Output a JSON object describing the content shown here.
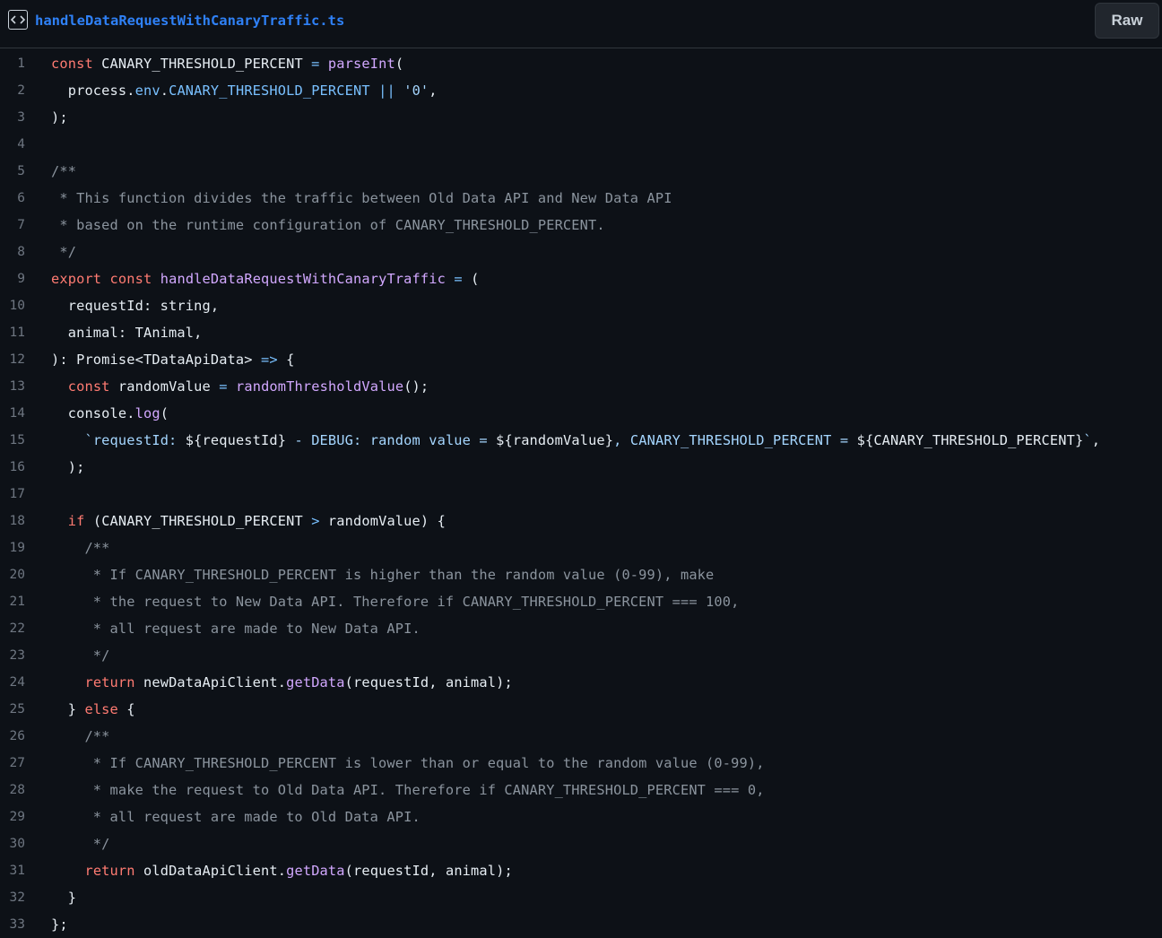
{
  "header": {
    "file_name": "handleDataRequestWithCanaryTraffic.ts",
    "raw_label": "Raw"
  },
  "icons": {
    "file_code": "code-file-icon"
  },
  "colors": {
    "background": "#0d1117",
    "keyword": "#ff7b72",
    "function": "#d2a8ff",
    "constant": "#79c0ff",
    "string": "#a5d6ff",
    "comment": "#8b949e",
    "text": "#e6edf3",
    "link": "#2f81f7"
  },
  "code": {
    "lines": [
      {
        "num": "1",
        "tokens": [
          [
            "keyword",
            "const"
          ],
          [
            "plain",
            " CANARY_THRESHOLD_PERCENT "
          ],
          [
            "const",
            "="
          ],
          [
            "plain",
            " "
          ],
          [
            "fn",
            "parseInt"
          ],
          [
            "plain",
            "("
          ]
        ]
      },
      {
        "num": "2",
        "tokens": [
          [
            "plain",
            "  process."
          ],
          [
            "const",
            "env"
          ],
          [
            "plain",
            "."
          ],
          [
            "const",
            "CANARY_THRESHOLD_PERCENT"
          ],
          [
            "plain",
            " "
          ],
          [
            "const",
            "||"
          ],
          [
            "plain",
            " "
          ],
          [
            "string",
            "'0'"
          ],
          [
            "plain",
            ","
          ]
        ]
      },
      {
        "num": "3",
        "tokens": [
          [
            "plain",
            ");"
          ]
        ]
      },
      {
        "num": "4",
        "tokens": []
      },
      {
        "num": "5",
        "tokens": [
          [
            "comment",
            "/**"
          ]
        ]
      },
      {
        "num": "6",
        "tokens": [
          [
            "comment",
            " * This function divides the traffic between Old Data API and New Data API"
          ]
        ]
      },
      {
        "num": "7",
        "tokens": [
          [
            "comment",
            " * based on the runtime configuration of CANARY_THRESHOLD_PERCENT."
          ]
        ]
      },
      {
        "num": "8",
        "tokens": [
          [
            "comment",
            " */"
          ]
        ]
      },
      {
        "num": "9",
        "tokens": [
          [
            "keyword",
            "export"
          ],
          [
            "plain",
            " "
          ],
          [
            "keyword",
            "const"
          ],
          [
            "plain",
            " "
          ],
          [
            "fn",
            "handleDataRequestWithCanaryTraffic"
          ],
          [
            "plain",
            " "
          ],
          [
            "const",
            "="
          ],
          [
            "plain",
            " ("
          ]
        ]
      },
      {
        "num": "10",
        "tokens": [
          [
            "plain",
            "  requestId: string,"
          ]
        ]
      },
      {
        "num": "11",
        "tokens": [
          [
            "plain",
            "  animal: TAnimal,"
          ]
        ]
      },
      {
        "num": "12",
        "tokens": [
          [
            "plain",
            "): Promise<TDataApiData> "
          ],
          [
            "const",
            "=>"
          ],
          [
            "plain",
            " {"
          ]
        ]
      },
      {
        "num": "13",
        "tokens": [
          [
            "plain",
            "  "
          ],
          [
            "keyword",
            "const"
          ],
          [
            "plain",
            " randomValue "
          ],
          [
            "const",
            "="
          ],
          [
            "plain",
            " "
          ],
          [
            "fn",
            "randomThresholdValue"
          ],
          [
            "plain",
            "();"
          ]
        ]
      },
      {
        "num": "14",
        "tokens": [
          [
            "plain",
            "  console."
          ],
          [
            "fn",
            "log"
          ],
          [
            "plain",
            "("
          ]
        ]
      },
      {
        "num": "15",
        "tokens": [
          [
            "plain",
            "    "
          ],
          [
            "string",
            "`requestId: "
          ],
          [
            "plain",
            "${requestId}"
          ],
          [
            "string",
            " - DEBUG: random value = "
          ],
          [
            "plain",
            "${randomValue}"
          ],
          [
            "string",
            ", CANARY_THRESHOLD_PERCENT = "
          ],
          [
            "plain",
            "${CANARY_THRESHOLD_PERCENT}"
          ],
          [
            "string",
            "`"
          ],
          [
            "plain",
            ","
          ]
        ]
      },
      {
        "num": "16",
        "tokens": [
          [
            "plain",
            "  );"
          ]
        ]
      },
      {
        "num": "17",
        "tokens": []
      },
      {
        "num": "18",
        "tokens": [
          [
            "plain",
            "  "
          ],
          [
            "keyword",
            "if"
          ],
          [
            "plain",
            " (CANARY_THRESHOLD_PERCENT "
          ],
          [
            "const",
            ">"
          ],
          [
            "plain",
            " randomValue) {"
          ]
        ]
      },
      {
        "num": "19",
        "tokens": [
          [
            "comment",
            "    /**"
          ]
        ]
      },
      {
        "num": "20",
        "tokens": [
          [
            "comment",
            "     * If CANARY_THRESHOLD_PERCENT is higher than the random value (0-99), make"
          ]
        ]
      },
      {
        "num": "21",
        "tokens": [
          [
            "comment",
            "     * the request to New Data API. Therefore if CANARY_THRESHOLD_PERCENT === 100,"
          ]
        ]
      },
      {
        "num": "22",
        "tokens": [
          [
            "comment",
            "     * all request are made to New Data API."
          ]
        ]
      },
      {
        "num": "23",
        "tokens": [
          [
            "comment",
            "     */"
          ]
        ]
      },
      {
        "num": "24",
        "tokens": [
          [
            "plain",
            "    "
          ],
          [
            "keyword",
            "return"
          ],
          [
            "plain",
            " newDataApiClient."
          ],
          [
            "fn",
            "getData"
          ],
          [
            "plain",
            "(requestId, animal);"
          ]
        ]
      },
      {
        "num": "25",
        "tokens": [
          [
            "plain",
            "  } "
          ],
          [
            "keyword",
            "else"
          ],
          [
            "plain",
            " {"
          ]
        ]
      },
      {
        "num": "26",
        "tokens": [
          [
            "comment",
            "    /**"
          ]
        ]
      },
      {
        "num": "27",
        "tokens": [
          [
            "comment",
            "     * If CANARY_THRESHOLD_PERCENT is lower than or equal to the random value (0-99),"
          ]
        ]
      },
      {
        "num": "28",
        "tokens": [
          [
            "comment",
            "     * make the request to Old Data API. Therefore if CANARY_THRESHOLD_PERCENT === 0,"
          ]
        ]
      },
      {
        "num": "29",
        "tokens": [
          [
            "comment",
            "     * all request are made to Old Data API."
          ]
        ]
      },
      {
        "num": "30",
        "tokens": [
          [
            "comment",
            "     */"
          ]
        ]
      },
      {
        "num": "31",
        "tokens": [
          [
            "plain",
            "    "
          ],
          [
            "keyword",
            "return"
          ],
          [
            "plain",
            " oldDataApiClient."
          ],
          [
            "fn",
            "getData"
          ],
          [
            "plain",
            "(requestId, animal);"
          ]
        ]
      },
      {
        "num": "32",
        "tokens": [
          [
            "plain",
            "  }"
          ]
        ]
      },
      {
        "num": "33",
        "tokens": [
          [
            "plain",
            "};"
          ]
        ]
      }
    ]
  }
}
